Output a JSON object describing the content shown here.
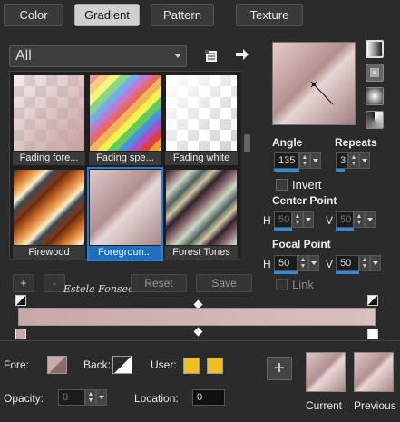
{
  "tabs": [
    {
      "label": "Color"
    },
    {
      "label": "Gradient"
    },
    {
      "label": "Pattern"
    },
    {
      "label": "Texture"
    }
  ],
  "category": {
    "selected": "All"
  },
  "presets": [
    {
      "label": "Fading fore..."
    },
    {
      "label": "Fading spe..."
    },
    {
      "label": "Fading white"
    },
    {
      "label": "Firewood"
    },
    {
      "label": "Foregroun..."
    },
    {
      "label": "Forest Tones"
    }
  ],
  "settings": {
    "angle_label": "Angle",
    "angle_value": "135",
    "repeats_label": "Repeats",
    "repeats_value": "3",
    "invert_label": "Invert",
    "center_point_label": "Center Point",
    "focal_point_label": "Focal Point",
    "h_label": "H",
    "v_label": "V",
    "center_h": "50",
    "center_v": "50",
    "focal_h": "50",
    "focal_v": "50",
    "link_label": "Link"
  },
  "editor": {
    "add_label": "+",
    "remove_label": "-",
    "reset_label": "Reset",
    "save_label": "Save",
    "watermark": "Estela Fonseca"
  },
  "footer": {
    "fore_label": "Fore:",
    "back_label": "Back:",
    "user_label": "User:",
    "opacity_label": "Opacity:",
    "opacity_value": "0",
    "location_label": "Location:",
    "location_value": "0",
    "current_label": "Current",
    "previous_label": "Previous",
    "add_icon": "+"
  },
  "colors": {
    "accent": "#2a7fd4",
    "user_swatch": "#f0c020",
    "gradient_start": "#c8a8a8",
    "gradient_end": "#d8c0c0"
  }
}
